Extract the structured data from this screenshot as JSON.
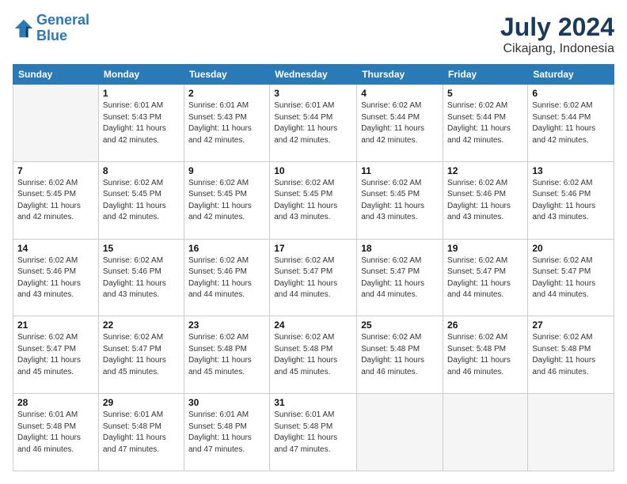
{
  "logo": {
    "line1": "General",
    "line2": "Blue"
  },
  "title": "July 2024",
  "location": "Cikajang, Indonesia",
  "days_header": [
    "Sunday",
    "Monday",
    "Tuesday",
    "Wednesday",
    "Thursday",
    "Friday",
    "Saturday"
  ],
  "weeks": [
    [
      {
        "num": "",
        "detail": ""
      },
      {
        "num": "1",
        "detail": "Sunrise: 6:01 AM\nSunset: 5:43 PM\nDaylight: 11 hours\nand 42 minutes."
      },
      {
        "num": "2",
        "detail": "Sunrise: 6:01 AM\nSunset: 5:43 PM\nDaylight: 11 hours\nand 42 minutes."
      },
      {
        "num": "3",
        "detail": "Sunrise: 6:01 AM\nSunset: 5:44 PM\nDaylight: 11 hours\nand 42 minutes."
      },
      {
        "num": "4",
        "detail": "Sunrise: 6:02 AM\nSunset: 5:44 PM\nDaylight: 11 hours\nand 42 minutes."
      },
      {
        "num": "5",
        "detail": "Sunrise: 6:02 AM\nSunset: 5:44 PM\nDaylight: 11 hours\nand 42 minutes."
      },
      {
        "num": "6",
        "detail": "Sunrise: 6:02 AM\nSunset: 5:44 PM\nDaylight: 11 hours\nand 42 minutes."
      }
    ],
    [
      {
        "num": "7",
        "detail": "Sunrise: 6:02 AM\nSunset: 5:45 PM\nDaylight: 11 hours\nand 42 minutes."
      },
      {
        "num": "8",
        "detail": "Sunrise: 6:02 AM\nSunset: 5:45 PM\nDaylight: 11 hours\nand 42 minutes."
      },
      {
        "num": "9",
        "detail": "Sunrise: 6:02 AM\nSunset: 5:45 PM\nDaylight: 11 hours\nand 42 minutes."
      },
      {
        "num": "10",
        "detail": "Sunrise: 6:02 AM\nSunset: 5:45 PM\nDaylight: 11 hours\nand 43 minutes."
      },
      {
        "num": "11",
        "detail": "Sunrise: 6:02 AM\nSunset: 5:45 PM\nDaylight: 11 hours\nand 43 minutes."
      },
      {
        "num": "12",
        "detail": "Sunrise: 6:02 AM\nSunset: 5:46 PM\nDaylight: 11 hours\nand 43 minutes."
      },
      {
        "num": "13",
        "detail": "Sunrise: 6:02 AM\nSunset: 5:46 PM\nDaylight: 11 hours\nand 43 minutes."
      }
    ],
    [
      {
        "num": "14",
        "detail": "Sunrise: 6:02 AM\nSunset: 5:46 PM\nDaylight: 11 hours\nand 43 minutes."
      },
      {
        "num": "15",
        "detail": "Sunrise: 6:02 AM\nSunset: 5:46 PM\nDaylight: 11 hours\nand 43 minutes."
      },
      {
        "num": "16",
        "detail": "Sunrise: 6:02 AM\nSunset: 5:46 PM\nDaylight: 11 hours\nand 44 minutes."
      },
      {
        "num": "17",
        "detail": "Sunrise: 6:02 AM\nSunset: 5:47 PM\nDaylight: 11 hours\nand 44 minutes."
      },
      {
        "num": "18",
        "detail": "Sunrise: 6:02 AM\nSunset: 5:47 PM\nDaylight: 11 hours\nand 44 minutes."
      },
      {
        "num": "19",
        "detail": "Sunrise: 6:02 AM\nSunset: 5:47 PM\nDaylight: 11 hours\nand 44 minutes."
      },
      {
        "num": "20",
        "detail": "Sunrise: 6:02 AM\nSunset: 5:47 PM\nDaylight: 11 hours\nand 44 minutes."
      }
    ],
    [
      {
        "num": "21",
        "detail": "Sunrise: 6:02 AM\nSunset: 5:47 PM\nDaylight: 11 hours\nand 45 minutes."
      },
      {
        "num": "22",
        "detail": "Sunrise: 6:02 AM\nSunset: 5:47 PM\nDaylight: 11 hours\nand 45 minutes."
      },
      {
        "num": "23",
        "detail": "Sunrise: 6:02 AM\nSunset: 5:48 PM\nDaylight: 11 hours\nand 45 minutes."
      },
      {
        "num": "24",
        "detail": "Sunrise: 6:02 AM\nSunset: 5:48 PM\nDaylight: 11 hours\nand 45 minutes."
      },
      {
        "num": "25",
        "detail": "Sunrise: 6:02 AM\nSunset: 5:48 PM\nDaylight: 11 hours\nand 46 minutes."
      },
      {
        "num": "26",
        "detail": "Sunrise: 6:02 AM\nSunset: 5:48 PM\nDaylight: 11 hours\nand 46 minutes."
      },
      {
        "num": "27",
        "detail": "Sunrise: 6:02 AM\nSunset: 5:48 PM\nDaylight: 11 hours\nand 46 minutes."
      }
    ],
    [
      {
        "num": "28",
        "detail": "Sunrise: 6:01 AM\nSunset: 5:48 PM\nDaylight: 11 hours\nand 46 minutes."
      },
      {
        "num": "29",
        "detail": "Sunrise: 6:01 AM\nSunset: 5:48 PM\nDaylight: 11 hours\nand 47 minutes."
      },
      {
        "num": "30",
        "detail": "Sunrise: 6:01 AM\nSunset: 5:48 PM\nDaylight: 11 hours\nand 47 minutes."
      },
      {
        "num": "31",
        "detail": "Sunrise: 6:01 AM\nSunset: 5:48 PM\nDaylight: 11 hours\nand 47 minutes."
      },
      {
        "num": "",
        "detail": ""
      },
      {
        "num": "",
        "detail": ""
      },
      {
        "num": "",
        "detail": ""
      }
    ]
  ]
}
